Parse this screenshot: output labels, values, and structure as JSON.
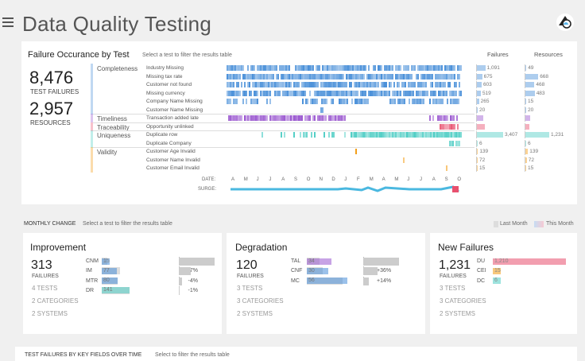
{
  "header": {
    "title": "Data Quality Testing"
  },
  "failures": {
    "title": "Failure Occurance by Test",
    "subtitle": "Select a test to filter the results table",
    "test_failures_value": "8,476",
    "test_failures_label": "TEST FAILURES",
    "resources_value": "2,957",
    "resources_label": "RESOURCES",
    "col_failures": "Failures",
    "col_resources": "Resources",
    "date_label": "DATE:",
    "surge_label": "SURGE:",
    "months": [
      "A",
      "M",
      "J",
      "J",
      "A",
      "S",
      "O",
      "N",
      "D",
      "J",
      "F",
      "M",
      "A",
      "M",
      "J",
      "J",
      "A",
      "S",
      "O"
    ],
    "categories": [
      {
        "name": "Completeness",
        "color": "#4a90d9"
      },
      {
        "name": "Timeliness",
        "color": "#9b59d0"
      },
      {
        "name": "Traceability",
        "color": "#e8506e"
      },
      {
        "name": "Uniqueness",
        "color": "#4ecdc4"
      },
      {
        "name": "Validity",
        "color": "#f39c12"
      }
    ],
    "tests": [
      {
        "cat": 0,
        "name": "Industry Missing",
        "failures": "1,091",
        "resources": "49",
        "fail_pct": 0.32,
        "res_pct": 0.04
      },
      {
        "cat": 0,
        "name": "Missing tax rate",
        "failures": "675",
        "resources": "668",
        "fail_pct": 0.2,
        "res_pct": 0.54
      },
      {
        "cat": 0,
        "name": "Customer not found",
        "failures": "603",
        "resources": "468",
        "fail_pct": 0.18,
        "res_pct": 0.38
      },
      {
        "cat": 0,
        "name": "Missing currency",
        "failures": "519",
        "resources": "483",
        "fail_pct": 0.15,
        "res_pct": 0.39
      },
      {
        "cat": 0,
        "name": "Company Name Missing",
        "failures": "265",
        "resources": "15",
        "fail_pct": 0.08,
        "res_pct": 0.02
      },
      {
        "cat": 0,
        "name": "Customer Name Missing",
        "failures": "20",
        "resources": "20",
        "fail_pct": 0.01,
        "res_pct": 0.02
      },
      {
        "cat": 1,
        "name": "Transaction added late",
        "failures": "",
        "resources": "",
        "fail_pct": 0.25,
        "res_pct": 0.2
      },
      {
        "cat": 2,
        "name": "Opportunity unlinked",
        "failures": "",
        "resources": "",
        "fail_pct": 0.3,
        "res_pct": 0.15
      },
      {
        "cat": 3,
        "name": "Duplicate row",
        "failures": "3,407",
        "resources": "1,231",
        "fail_pct": 1.0,
        "res_pct": 1.0
      },
      {
        "cat": 3,
        "name": "Duplicate Company",
        "failures": "6",
        "resources": "6",
        "fail_pct": 0.01,
        "res_pct": 0.01
      },
      {
        "cat": 4,
        "name": "Customer Age Invalid",
        "failures": "139",
        "resources": "139",
        "fail_pct": 0.04,
        "res_pct": 0.11
      },
      {
        "cat": 4,
        "name": "Customer Name Invalid",
        "failures": "72",
        "resources": "72",
        "fail_pct": 0.02,
        "res_pct": 0.06
      },
      {
        "cat": 4,
        "name": "Customer Email Invalid",
        "failures": "15",
        "resources": "15",
        "fail_pct": 0.01,
        "res_pct": 0.01
      }
    ]
  },
  "monthly": {
    "title": "MONTHLY CHANGE",
    "subtitle": "Select a test to filter the results table",
    "legend_last": "Last Month",
    "legend_this": "This Month",
    "improvement": {
      "title": "Improvement",
      "value": "313",
      "label": "FAILURES",
      "tests": "4 TESTS",
      "categories": "2 CATEGORIES",
      "systems": "2 SYSTEMS",
      "rows": [
        {
          "code": "CNM",
          "val": "15",
          "pct": "-50%",
          "cur": 0.05,
          "prev": 0.1,
          "chg": 1.0,
          "color": "#4a90d9"
        },
        {
          "code": "IM",
          "val": "77",
          "pct": "-17%",
          "cur": 0.28,
          "prev": 0.34,
          "chg": 0.34,
          "color": "#4a90d9"
        },
        {
          "code": "MTR",
          "val": "80",
          "pct": "-4%",
          "cur": 0.29,
          "prev": 0.3,
          "chg": 0.08,
          "color": "#4a90d9"
        },
        {
          "code": "DR",
          "val": "141",
          "pct": "-1%",
          "cur": 0.52,
          "prev": 0.52,
          "chg": 0.02,
          "color": "#4ecdc4"
        }
      ]
    },
    "degradation": {
      "title": "Degradation",
      "value": "120",
      "label": "FAILURES",
      "tests": "3 TESTS",
      "categories": "3 CATEGORIES",
      "systems": "2 SYSTEMS",
      "rows": [
        {
          "code": "TAL",
          "val": "34",
          "pct": "+89%",
          "cur": 0.45,
          "prev": 0.24,
          "chg": 1.0,
          "color": "#9b59d0"
        },
        {
          "code": "CNF",
          "val": "30",
          "pct": "+36%",
          "cur": 0.4,
          "prev": 0.3,
          "chg": 0.4,
          "color": "#4a90d9"
        },
        {
          "code": "MC",
          "val": "56",
          "pct": "+14%",
          "cur": 0.75,
          "prev": 0.66,
          "chg": 0.16,
          "color": "#4a90d9"
        }
      ]
    },
    "new_failures": {
      "title": "New Failures",
      "value": "1,231",
      "label": "FAILURES",
      "tests": "3 TESTS",
      "categories": "3 CATEGORIES",
      "systems": "2 SYSTEMS",
      "rows": [
        {
          "code": "DU",
          "val": "1,210",
          "cur": 1.0,
          "color": "#e8506e"
        },
        {
          "code": "CEI",
          "val": "15",
          "cur": 0.01,
          "color": "#f39c12"
        },
        {
          "code": "DC",
          "val": "6",
          "cur": 0.005,
          "color": "#4ecdc4"
        }
      ]
    }
  },
  "bottom": {
    "title": "TEST FAILURES BY KEY FIELDS OVER TIME",
    "subtitle": "Select to filter the results table"
  }
}
